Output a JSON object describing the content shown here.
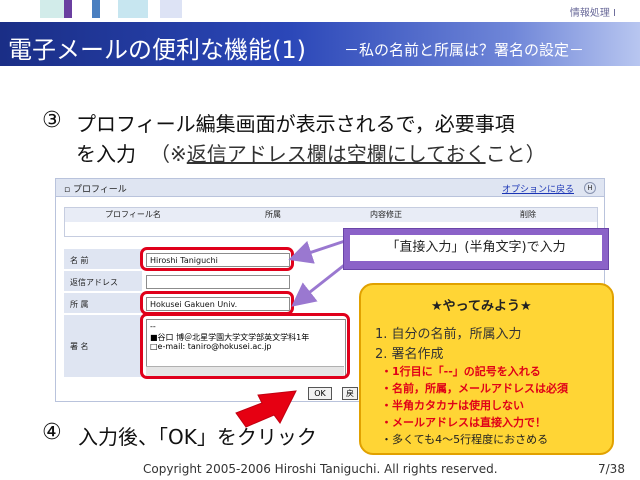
{
  "header": {
    "course": "情報処理 Ⅰ",
    "title": "電子メールの便利な機能(1)",
    "subtitle": "－私の名前と所属は？署名の設定－"
  },
  "step3": {
    "num": "③",
    "line1": "プロフィール編集画面が表示されるで，必要事項",
    "line2_pre": "を入力",
    "line2_hint_open": "（※",
    "line2_hint_under": "返信アドレス欄は空欄にしておく",
    "line2_hint_close": "こと）"
  },
  "screenshot": {
    "title": "プロフィール",
    "options_link": "オプションに戻る",
    "help_icon": "H",
    "columns": [
      "プロフィール名",
      "所属",
      "内容修正",
      "削除"
    ],
    "fields": {
      "name_label": "名 前",
      "name_value": "Hiroshi Taniguchi",
      "reply_label": "返信アドレス",
      "reply_value": "",
      "affil_label": "所 属",
      "affil_value": "Hokusei Gakuen Univ.",
      "sig_label": "署 名",
      "sig_line1": "--",
      "sig_line2": "■谷口 博＠北星学園大学文学部英文学科1年",
      "sig_line3": "□e-mail: taniro@hokusei.ac.jp"
    },
    "ok_label": "OK",
    "back_label": "戻る"
  },
  "callout_purple": "「直接入力」(半角文字)で入力",
  "callout_yellow": {
    "title": "★やってみよう★",
    "item1": "1. 自分の名前，所属入力",
    "item2": "2. 署名作成",
    "red1": "・1行目に「--」の記号を入れる",
    "red2": "・名前，所属，メールアドレスは必須",
    "red3": "・半角カタカナは使用しない",
    "red4": "・メールアドレスは直接入力で！",
    "last": "・多くても4～5行程度におさめる"
  },
  "step4": {
    "num": "④",
    "text": "入力後、「OK」をクリック"
  },
  "footer": {
    "copyright": "Copyright 2005-2006 Hiroshi Taniguchi. All rights reserved.",
    "page": "7/38"
  },
  "colors": {
    "title_bar": "#2b47b8",
    "highlight_red": "#e0001b",
    "callout_purple": "#8b62c8",
    "callout_yellow": "#ffd535",
    "arrow_red": "#e60012"
  }
}
